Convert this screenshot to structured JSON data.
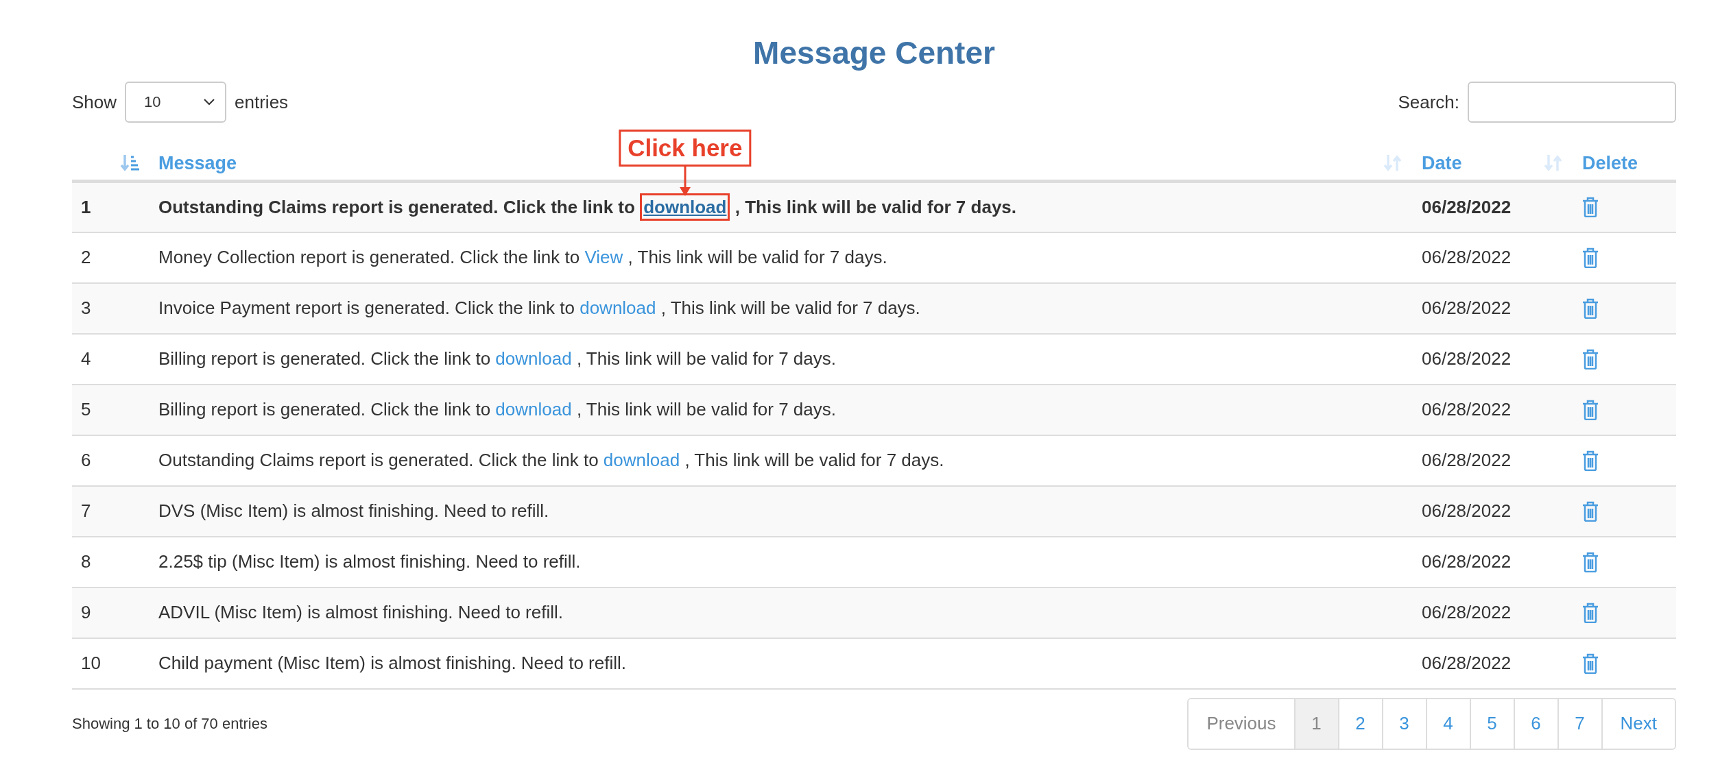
{
  "title": "Message Center",
  "length_menu": {
    "before": "Show",
    "value": "10",
    "after": "entries"
  },
  "search": {
    "label": "Search:"
  },
  "columns": [
    {
      "sorted": true
    },
    {
      "label": "Message",
      "sorted": false
    },
    {
      "label": "Date",
      "sorted": false
    },
    {
      "label": "Delete"
    }
  ],
  "rows": [
    {
      "index": "1",
      "unread": true,
      "before": "Outstanding Claims report is generated. Click the link to ",
      "link": "download",
      "after": " , This link will be valid for 7 days.",
      "date": "06/28/2022",
      "callout": "Click here"
    },
    {
      "index": "2",
      "unread": false,
      "before": "Money Collection report is generated. Click the link to ",
      "link": "View",
      "after": " , This link will be valid for 7 days.",
      "date": "06/28/2022"
    },
    {
      "index": "3",
      "unread": false,
      "before": "Invoice Payment report is generated. Click the link to ",
      "link": "download",
      "after": " , This link will be valid for 7 days.",
      "date": "06/28/2022"
    },
    {
      "index": "4",
      "unread": false,
      "before": "Billing report is generated. Click the link to ",
      "link": "download",
      "after": " , This link will be valid for 7 days.",
      "date": "06/28/2022"
    },
    {
      "index": "5",
      "unread": false,
      "before": "Billing report is generated. Click the link to ",
      "link": "download",
      "after": " , This link will be valid for 7 days.",
      "date": "06/28/2022"
    },
    {
      "index": "6",
      "unread": false,
      "before": "Outstanding Claims report is generated. Click the link to ",
      "link": "download",
      "after": " , This link will be valid for 7 days.",
      "date": "06/28/2022"
    },
    {
      "index": "7",
      "unread": false,
      "before": "DVS (Misc Item) is almost finishing. Need to refill.",
      "date": "06/28/2022"
    },
    {
      "index": "8",
      "unread": false,
      "before": "2.25$ tip (Misc Item) is almost finishing. Need to refill.",
      "date": "06/28/2022"
    },
    {
      "index": "9",
      "unread": false,
      "before": "ADVIL (Misc Item) is almost finishing. Need to refill.",
      "date": "06/28/2022"
    },
    {
      "index": "10",
      "unread": false,
      "before": "Child payment (Misc Item) is almost finishing. Need to refill.",
      "date": "06/28/2022"
    }
  ],
  "info": "Showing 1 to 10 of 70 entries",
  "pagination": [
    {
      "label": "Previous",
      "kind": "nav",
      "disabled": true,
      "selected": false
    },
    {
      "label": "1",
      "kind": "page",
      "selected": true
    },
    {
      "label": "2",
      "kind": "page",
      "selected": false
    },
    {
      "label": "3",
      "kind": "page",
      "selected": false
    },
    {
      "label": "4",
      "kind": "page",
      "selected": false
    },
    {
      "label": "5",
      "kind": "page",
      "selected": false
    },
    {
      "label": "6",
      "kind": "page",
      "selected": false
    },
    {
      "label": "7",
      "kind": "page",
      "selected": false
    },
    {
      "label": "Next",
      "kind": "nav",
      "disabled": false,
      "selected": false
    }
  ]
}
